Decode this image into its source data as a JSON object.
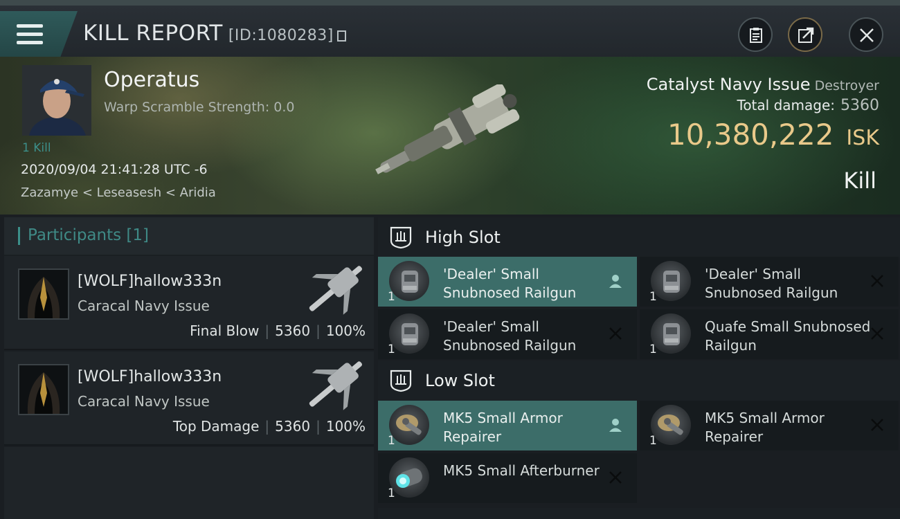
{
  "window": {
    "title": "KILL REPORT",
    "report_id": "[ID:1080283]"
  },
  "victim": {
    "pilot_name": "Operatus",
    "warp_scramble": "Warp Scramble Strength: 0.0",
    "kills": "1 Kill",
    "datetime": "2020/09/04 21:41:28 UTC -6",
    "location": "Zazamye < Leseasesh < Aridia",
    "ship_name": "Catalyst Navy Issue",
    "ship_class": "Destroyer",
    "total_damage_label": "Total damage:",
    "total_damage_value": "5360",
    "isk_value": "10,380,222",
    "isk_unit": "ISK",
    "result": "Kill"
  },
  "participants": {
    "header": "Participants [1]",
    "items": [
      {
        "name": "[WOLF]hallow333n",
        "ship": "Caracal Navy Issue",
        "role": "Final Blow",
        "damage": "5360",
        "percent": "100%"
      },
      {
        "name": "[WOLF]hallow333n",
        "ship": "Caracal Navy Issue",
        "role": "Top Damage",
        "damage": "5360",
        "percent": "100%"
      }
    ]
  },
  "slots": {
    "high": {
      "title": "High Slot",
      "items": [
        {
          "name": "'Dealer' Small Snubnosed Railgun",
          "qty": "1",
          "status": "fitted"
        },
        {
          "name": "'Dealer' Small Snubnosed Railgun",
          "qty": "1",
          "status": "destroyed"
        },
        {
          "name": "'Dealer' Small Snubnosed Railgun",
          "qty": "1",
          "status": "destroyed"
        },
        {
          "name": "Quafe Small Snubnosed Railgun",
          "qty": "1",
          "status": "destroyed"
        }
      ]
    },
    "low": {
      "title": "Low Slot",
      "items": [
        {
          "name": "MK5 Small Armor Repairer",
          "qty": "1",
          "status": "fitted"
        },
        {
          "name": "MK5 Small Armor Repairer",
          "qty": "1",
          "status": "destroyed"
        },
        {
          "name": "MK5 Small Afterburner",
          "qty": "1",
          "status": "destroyed"
        }
      ]
    }
  },
  "icons": {
    "menu": "hamburger-icon",
    "clipboard": "clipboard-icon",
    "share": "share-icon",
    "close": "close-icon",
    "slot": "slot-shield-icon",
    "fitted": "person-icon",
    "destroyed": "x-icon"
  },
  "colors": {
    "accent_teal": "#3c8f8a",
    "selected_row": "#3c6d69",
    "isk_gold": "#e9c98a"
  }
}
